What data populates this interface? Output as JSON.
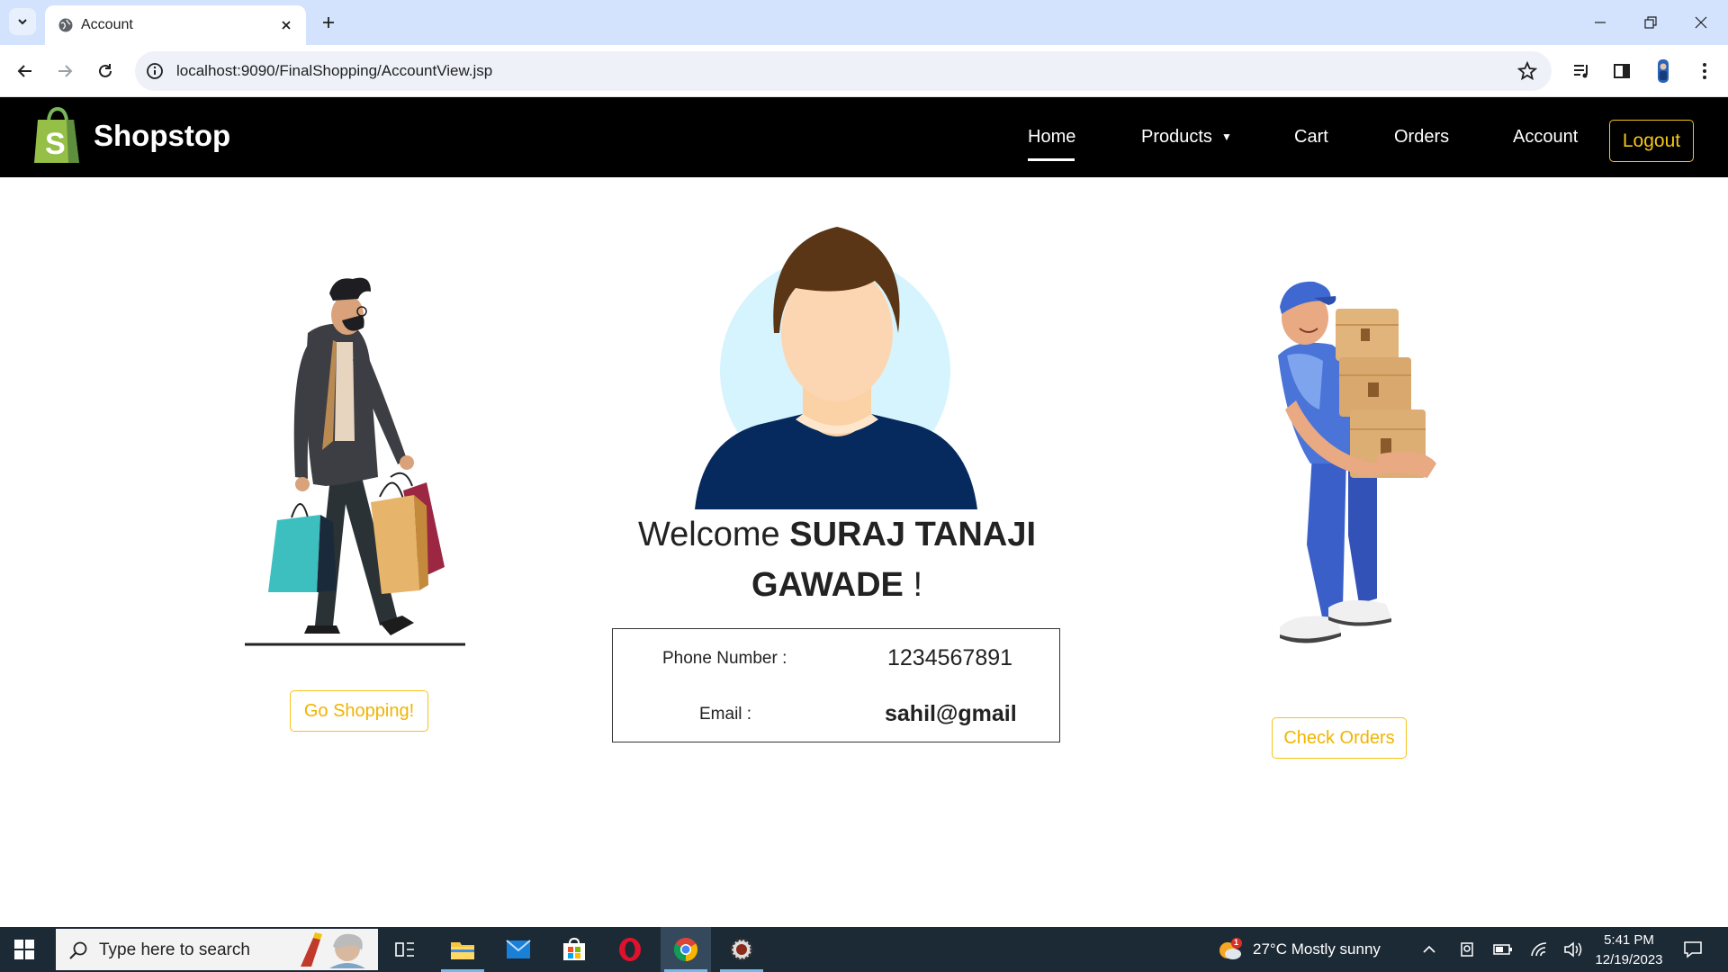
{
  "browser": {
    "tab_title": "Account",
    "url": "localhost:9090/FinalShopping/AccountView.jsp"
  },
  "site": {
    "brand": "Shopstop",
    "nav": {
      "home": "Home",
      "products": "Products",
      "cart": "Cart",
      "orders": "Orders",
      "account": "Account",
      "logout": "Logout"
    },
    "accent_color": "#f5c518"
  },
  "account": {
    "welcome_prefix": "Welcome",
    "user_name": "SURAJ TANAJI GAWADE",
    "welcome_suffix": "!",
    "phone_label": "Phone Number :",
    "phone_value": "1234567891",
    "email_label": "Email :",
    "email_value": "sahil@gmail"
  },
  "actions": {
    "go_shopping": "Go Shopping!",
    "check_orders": "Check Orders"
  },
  "taskbar": {
    "search_placeholder": "Type here to search",
    "weather": "27°C  Mostly sunny",
    "weather_badge": "1",
    "time": "5:41 PM",
    "date": "12/19/2023"
  }
}
